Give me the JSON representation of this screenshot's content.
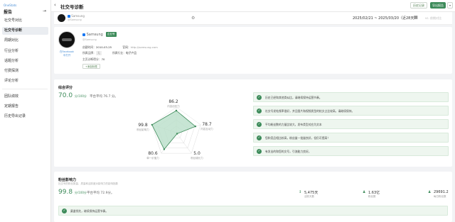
{
  "sidebar": {
    "brand": "OneStats",
    "title": "报告",
    "items": [
      {
        "label": "社交号对比"
      },
      {
        "label": "社交号诊断"
      },
      {
        "label": "周期对比"
      },
      {
        "label": "行业分析"
      },
      {
        "label": "话题分析"
      },
      {
        "label": "付费探测"
      },
      {
        "label": "评论分析"
      },
      {
        "label": "团队绩效"
      },
      {
        "label": "定期报告"
      },
      {
        "label": "历史导出记录"
      }
    ]
  },
  "header": {
    "title": "社交号诊断",
    "btn_history": "历史记录",
    "btn_export": "导出报告",
    "btn_more": "▾"
  },
  "account_bar": {
    "name": "Samsung",
    "handle": "@Samsung",
    "date_range": "2025/02/21 ~ 2025/03/20（近28天）",
    "compare": "vs. 前期对比"
  },
  "profile": {
    "name": "Samsung",
    "badge": "企业号",
    "handle": "@Samsung",
    "fb_link_line1": "在Facebook",
    "fb_link_line2": "中打开",
    "created_label": "创建时间：",
    "created_value": "2010-03-25",
    "website_label": "官网：",
    "website_value": "http://samsung.com",
    "brand_label": "所属品牌：",
    "brand_value": "无",
    "industry_label": "所属行业：",
    "industry_value": "电子产品",
    "score_label": "主页诊断得分：",
    "score_value": "70",
    "add_button": "+添加标签"
  },
  "composite": {
    "title": "综合评分",
    "score": "70.0",
    "unit": "分/100分",
    "avg": "平台平均 76.7 分。",
    "radar": [
      {
        "value": "86.2",
        "label": "内容创作力"
      },
      {
        "value": "78.7",
        "label": "内容互动力"
      },
      {
        "value": "5.0",
        "label": "粉丝增长力"
      },
      {
        "value": "80.6",
        "label": "单一价值力"
      },
      {
        "value": "99.8",
        "label": "粉丝影响力"
      }
    ],
    "radar_fractions": [
      0.862,
      0.787,
      0.05,
      0.806,
      0.998
    ],
    "insights": [
      "历史已经和其他类似比，请继续保持运营节奏。",
      "社交号发帖频率很好，并且图片和视频类型的帖文占比较高，请继续保持。",
      "平均粉丝数的力量比较大，发布类型对应为文本",
      "您和竞品相比较高，粉丝量一批量良好，但仍可提高！",
      "有发出的和您的文号，引流能力良好。"
    ]
  },
  "influence": {
    "title": "粉丝影响力",
    "subtitle": "社交号的粉丝数量、质量和活跃度对影响力的影响指数",
    "score": "99.8",
    "unit": "分/100分",
    "avg": "平台平均 72.9分。",
    "metrics": [
      {
        "icon": "↕",
        "value": "5,475天",
        "label": "活跃天数"
      },
      {
        "icon": "♟",
        "value": "1.63亿",
        "label": "粉丝数"
      },
      {
        "icon": "♟",
        "value": "29691.2",
        "label": "每日粉丝数"
      }
    ],
    "insight": "渠道领先，继续保持运营节奏。"
  },
  "colors": {
    "accent": "#3d8b5a",
    "insight_bg": "#eef6ef",
    "radar_fill": "#b9dfc9"
  }
}
